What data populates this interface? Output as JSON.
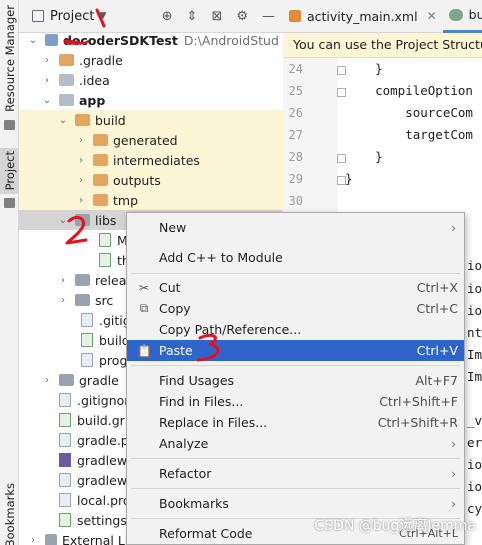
{
  "left_strip": {
    "tabs": [
      "Resource Manager",
      "Project",
      "Bookmarks"
    ]
  },
  "project_panel": {
    "title": "Project",
    "header_icons": [
      "target-icon",
      "collapse-icon",
      "expand-icon",
      "gear-icon",
      "hide-icon"
    ],
    "tree": [
      {
        "label": "decoderSDKTest",
        "path": "D:\\AndroidStud",
        "icon": "module-icon"
      },
      {
        "label": ".gradle",
        "icon": "folder-orange"
      },
      {
        "label": ".idea",
        "icon": "folder-gray"
      },
      {
        "label": "app",
        "icon": "module-folder"
      },
      {
        "label": "build",
        "icon": "folder-orange"
      },
      {
        "label": "generated",
        "icon": "folder-orange"
      },
      {
        "label": "intermediates",
        "icon": "folder-orange"
      },
      {
        "label": "outputs",
        "icon": "folder-orange"
      },
      {
        "label": "tmp",
        "icon": "folder-orange"
      },
      {
        "label": "libs",
        "icon": "folder-gray"
      },
      {
        "label": "M",
        "icon": "file"
      },
      {
        "label": "th",
        "icon": "file"
      },
      {
        "label": "relea",
        "icon": "folder-gray"
      },
      {
        "label": "src",
        "icon": "folder-gray"
      },
      {
        "label": ".gitig",
        "icon": "file"
      },
      {
        "label": "build",
        "icon": "gradle-file"
      },
      {
        "label": "prog",
        "icon": "file"
      },
      {
        "label": "gradle",
        "icon": "folder-gray"
      },
      {
        "label": ".gitignor",
        "icon": "file"
      },
      {
        "label": "build.gr",
        "icon": "gradle-file"
      },
      {
        "label": "gradle.p",
        "icon": "file"
      },
      {
        "label": "gradlew",
        "icon": "file"
      },
      {
        "label": "gradlew",
        "icon": "file"
      },
      {
        "label": "local.pro",
        "icon": "file"
      },
      {
        "label": "settings",
        "icon": "gradle-file"
      },
      {
        "label": "External Lib",
        "icon": "library-icon"
      }
    ]
  },
  "editor": {
    "tabs": [
      {
        "label": "activity_main.xml"
      },
      {
        "label": "buil"
      }
    ],
    "banner": "You can use the Project Structure",
    "line_numbers": [
      "24",
      "25",
      "26",
      "27",
      "28",
      "29",
      "30"
    ],
    "code_lines": [
      "    }",
      "    compileOption",
      "        sourceCom",
      "        targetCom",
      "    }",
      "}",
      ""
    ],
    "right_fragments": [
      "io",
      "io",
      "io",
      "nt",
      "Im",
      "Im",
      "_v",
      "er",
      "io",
      "io",
      "cy"
    ]
  },
  "context_menu": {
    "items": [
      {
        "label": "New",
        "shortcut": "",
        "submenu": true
      },
      {
        "label": "Add C++ to Module",
        "shortcut": ""
      },
      {
        "label": "Cut",
        "shortcut": "Ctrl+X",
        "icon": "scissors-icon"
      },
      {
        "label": "Copy",
        "shortcut": "Ctrl+C",
        "icon": "copy-icon"
      },
      {
        "label": "Copy Path/Reference...",
        "shortcut": ""
      },
      {
        "label": "Paste",
        "shortcut": "Ctrl+V",
        "icon": "paste-icon",
        "selected": true
      },
      {
        "label": "Find Usages",
        "shortcut": "Alt+F7"
      },
      {
        "label": "Find in Files...",
        "shortcut": "Ctrl+Shift+F"
      },
      {
        "label": "Replace in Files...",
        "shortcut": "Ctrl+Shift+R"
      },
      {
        "label": "Analyze",
        "shortcut": "",
        "submenu": true
      },
      {
        "label": "Refactor",
        "shortcut": "",
        "submenu": true
      },
      {
        "label": "Bookmarks",
        "shortcut": "",
        "submenu": true
      },
      {
        "label": "Reformat Code",
        "shortcut": "Ctrl+Alt+L"
      }
    ]
  },
  "annotations": [
    "1",
    "2",
    "3"
  ],
  "watermark": "CSDN @bug远离Jemma",
  "colors": {
    "selection": "#2f65ca",
    "folder_orange": "#e5a45f",
    "annotation_red": "#e0141e"
  }
}
